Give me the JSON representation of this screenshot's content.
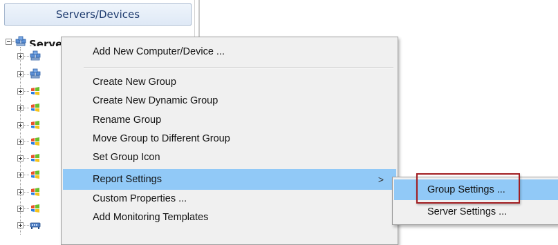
{
  "panel": {
    "header": "Servers/Devices",
    "root_label": "Servers/Devices"
  },
  "tree": {
    "nodes": [
      {
        "icon": "server-group-icon"
      },
      {
        "icon": "server-group-icon"
      },
      {
        "icon": "windows-icon"
      },
      {
        "icon": "windows-icon"
      },
      {
        "icon": "windows-icon"
      },
      {
        "icon": "windows-icon"
      },
      {
        "icon": "windows-icon"
      },
      {
        "icon": "windows-icon"
      },
      {
        "icon": "windows-icon"
      },
      {
        "icon": "windows-icon"
      },
      {
        "icon": "network-device-icon"
      }
    ]
  },
  "menu": {
    "items": [
      {
        "label": "Add New Computer/Device ..."
      },
      {
        "label": "Create New Group"
      },
      {
        "label": "Create New Dynamic Group"
      },
      {
        "label": "Rename Group"
      },
      {
        "label": "Move Group to Different Group"
      },
      {
        "label": "Set Group Icon"
      },
      {
        "label": "Report Settings",
        "submenu_arrow": ">"
      },
      {
        "label": "Custom Properties ..."
      },
      {
        "label": "Add Monitoring Templates"
      }
    ],
    "highlighted_item": "Report Settings"
  },
  "submenu": {
    "items": [
      {
        "label": "Group Settings ..."
      },
      {
        "label": "Server Settings ..."
      }
    ],
    "highlighted_item": "Group Settings ..."
  },
  "colors": {
    "highlight": "#91c9f7",
    "callout": "#a11d21",
    "menu_bg": "#f0f0f0"
  }
}
